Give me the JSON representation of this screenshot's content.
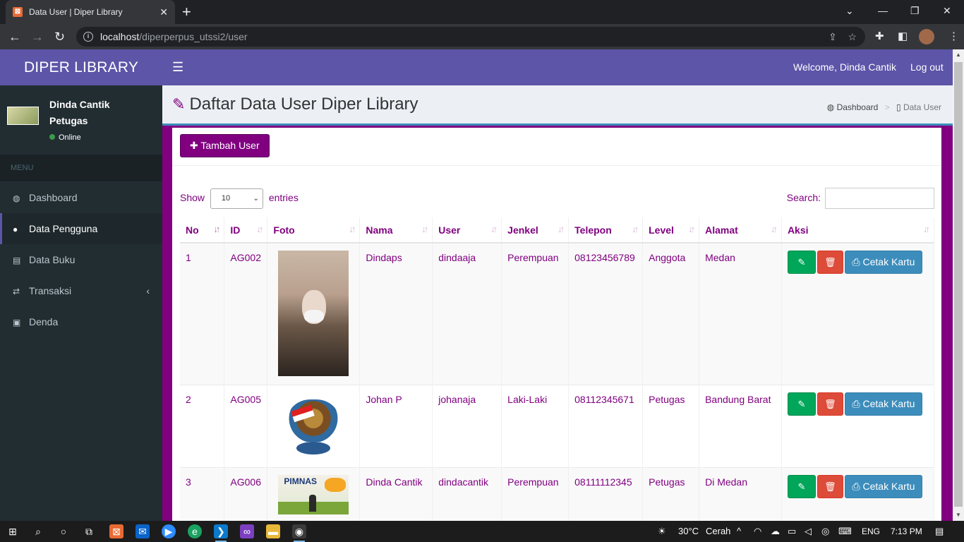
{
  "browser": {
    "tab_title": "Data User | Diper Library",
    "favicon": "xampp-icon",
    "url_host": "localhost",
    "url_path": "/diperperpus_utssi2/user"
  },
  "app": {
    "brand": "DIPER LIBRARY",
    "welcome": "Welcome, Dinda Cantik",
    "logout": "Log out",
    "colors": {
      "primary": "#800080",
      "header": "#5c55a8",
      "sidebar": "#222d32"
    }
  },
  "user_panel": {
    "name": "Dinda Cantik",
    "role": "Petugas",
    "status": "Online"
  },
  "sidebar": {
    "header": "MENU",
    "items": [
      {
        "label": "Dashboard",
        "icon": "dashboard-icon"
      },
      {
        "label": "Data Pengguna",
        "icon": "user-icon"
      },
      {
        "label": "Data Buku",
        "icon": "book-icon"
      },
      {
        "label": "Transaksi",
        "icon": "exchange-icon"
      },
      {
        "label": "Denda",
        "icon": "money-icon"
      }
    ]
  },
  "page": {
    "title": "Daftar Data User Diper Library",
    "breadcrumb": [
      "Dashboard",
      "Data User"
    ],
    "add_button": "Tambah User",
    "show_label": "Show",
    "entries_label": "entries",
    "page_length": "10",
    "search_label": "Search:"
  },
  "table": {
    "columns": [
      "No",
      "ID",
      "Foto",
      "Nama",
      "User",
      "Jenkel",
      "Telepon",
      "Level",
      "Alamat",
      "Aksi"
    ],
    "rows": [
      {
        "no": "1",
        "id": "AG002",
        "nama": "Dindaps",
        "user": "dindaaja",
        "jenkel": "Perempuan",
        "telepon": "08123456789",
        "level": "Anggota",
        "alamat": "Medan"
      },
      {
        "no": "2",
        "id": "AG005",
        "nama": "Johan P",
        "user": "johanaja",
        "jenkel": "Laki-Laki",
        "telepon": "08112345671",
        "level": "Petugas",
        "alamat": "Bandung Barat"
      },
      {
        "no": "3",
        "id": "AG006",
        "nama": "Dinda Cantik",
        "user": "dindacantik",
        "jenkel": "Perempuan",
        "telepon": "08111112345",
        "level": "Petugas",
        "alamat": "Di Medan"
      }
    ],
    "print_label": "Cetak Kartu"
  },
  "taskbar": {
    "temp": "30°C",
    "weather": "Cerah",
    "lang": "ENG",
    "time": "7:13 PM"
  }
}
